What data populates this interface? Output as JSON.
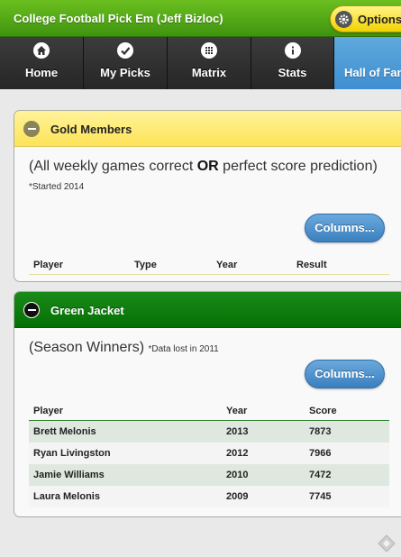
{
  "header": {
    "title": "College Football Pick Em (Jeff Bizloc)",
    "options_label": "Options"
  },
  "nav": {
    "tabs": [
      {
        "label": "Home",
        "icon": "home-icon"
      },
      {
        "label": "My Picks",
        "icon": "check-icon"
      },
      {
        "label": "Matrix",
        "icon": "grid-icon"
      },
      {
        "label": "Stats",
        "icon": "info-icon"
      },
      {
        "label": "Hall of Fame",
        "icon": "",
        "active": true
      }
    ]
  },
  "gold": {
    "title": "Gold Members",
    "desc_prefix": "(All weekly games correct ",
    "desc_bold": "OR",
    "desc_suffix": " perfect score prediction)",
    "note": "*Started 2014",
    "columns_label": "Columns...",
    "headers": [
      "Player",
      "Type",
      "Year",
      "Result"
    ],
    "rows": []
  },
  "green": {
    "title": "Green Jacket",
    "desc": "(Season Winners)",
    "note": "*Data lost in 2011",
    "columns_label": "Columns...",
    "headers": [
      "Player",
      "Year",
      "Score"
    ],
    "rows": [
      {
        "player": "Brett Melonis",
        "year": "2013",
        "score": "7873"
      },
      {
        "player": "Ryan Livingston",
        "year": "2012",
        "score": "7966"
      },
      {
        "player": "Jamie Williams",
        "year": "2010",
        "score": "7472"
      },
      {
        "player": "Laura Melonis",
        "year": "2009",
        "score": "7745"
      }
    ]
  },
  "colors": {
    "header_green": "#3f9410",
    "nav_active": "#4a99d6",
    "gold_bar": "#fde357",
    "green_bar": "#047004",
    "button_blue": "#3a7fbf"
  }
}
